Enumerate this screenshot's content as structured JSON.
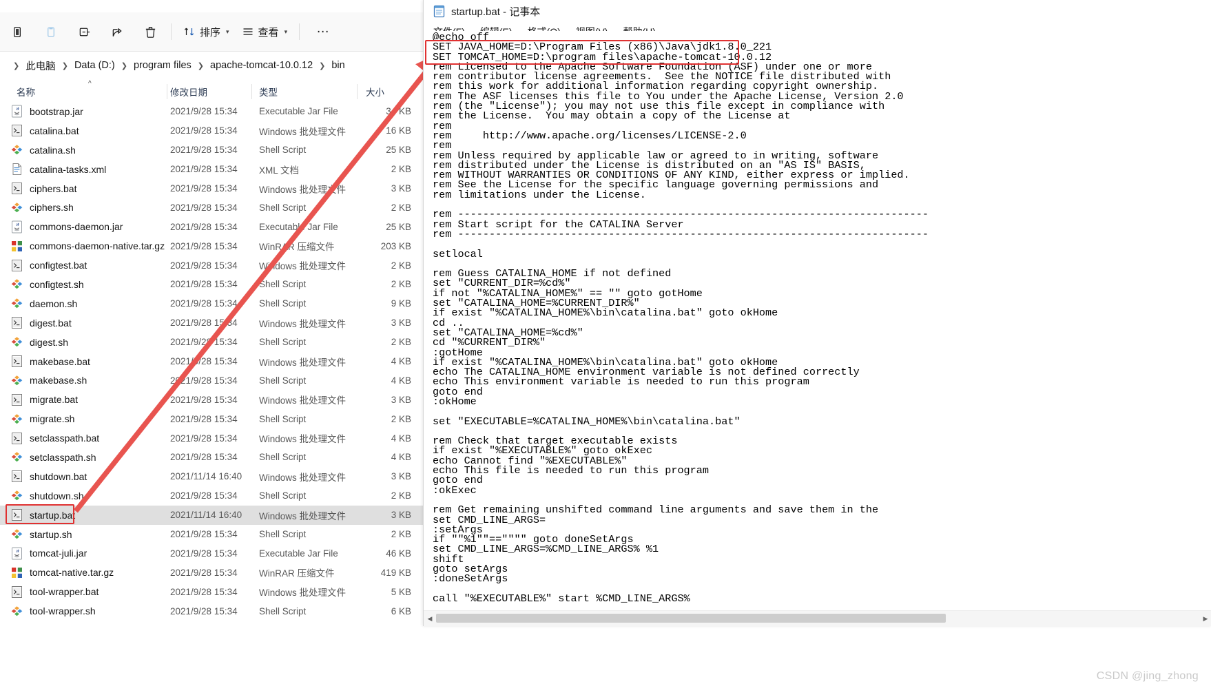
{
  "explorer": {
    "toolbar": {
      "buttons": [
        {
          "name": "cut-icon",
          "label": "剪切"
        },
        {
          "name": "copy-icon",
          "label": "复制"
        },
        {
          "name": "paste-icon",
          "label": "粘贴"
        },
        {
          "name": "share-icon",
          "label": "共享"
        },
        {
          "name": "delete-icon",
          "label": "删除"
        }
      ],
      "sort_label": "排序",
      "view_label": "查看",
      "more_label": "…"
    },
    "breadcrumb": [
      "此电脑",
      "Data (D:)",
      "program files",
      "apache-tomcat-10.0.12",
      "bin"
    ],
    "columns": {
      "name": "名称",
      "date": "修改日期",
      "type": "类型",
      "size": "大小"
    },
    "files": [
      {
        "icon": "jar-file-icon",
        "name": "bootstrap.jar",
        "date": "2021/9/28 15:34",
        "type": "Executable Jar File",
        "size": "34 KB",
        "selected": false
      },
      {
        "icon": "bat-file-icon",
        "name": "catalina.bat",
        "date": "2021/9/28 15:34",
        "type": "Windows 批处理文件",
        "size": "16 KB",
        "selected": false
      },
      {
        "icon": "sh-file-icon",
        "name": "catalina.sh",
        "date": "2021/9/28 15:34",
        "type": "Shell Script",
        "size": "25 KB",
        "selected": false
      },
      {
        "icon": "xml-file-icon",
        "name": "catalina-tasks.xml",
        "date": "2021/9/28 15:34",
        "type": "XML 文档",
        "size": "2 KB",
        "selected": false
      },
      {
        "icon": "bat-file-icon",
        "name": "ciphers.bat",
        "date": "2021/9/28 15:34",
        "type": "Windows 批处理文件",
        "size": "3 KB",
        "selected": false
      },
      {
        "icon": "sh-file-icon",
        "name": "ciphers.sh",
        "date": "2021/9/28 15:34",
        "type": "Shell Script",
        "size": "2 KB",
        "selected": false
      },
      {
        "icon": "jar-file-icon",
        "name": "commons-daemon.jar",
        "date": "2021/9/28 15:34",
        "type": "Executable Jar File",
        "size": "25 KB",
        "selected": false
      },
      {
        "icon": "winrar-file-icon",
        "name": "commons-daemon-native.tar.gz",
        "date": "2021/9/28 15:34",
        "type": "WinRAR 压缩文件",
        "size": "203 KB",
        "selected": false
      },
      {
        "icon": "bat-file-icon",
        "name": "configtest.bat",
        "date": "2021/9/28 15:34",
        "type": "Windows 批处理文件",
        "size": "2 KB",
        "selected": false
      },
      {
        "icon": "sh-file-icon",
        "name": "configtest.sh",
        "date": "2021/9/28 15:34",
        "type": "Shell Script",
        "size": "2 KB",
        "selected": false
      },
      {
        "icon": "sh-file-icon",
        "name": "daemon.sh",
        "date": "2021/9/28 15:34",
        "type": "Shell Script",
        "size": "9 KB",
        "selected": false
      },
      {
        "icon": "bat-file-icon",
        "name": "digest.bat",
        "date": "2021/9/28 15:34",
        "type": "Windows 批处理文件",
        "size": "3 KB",
        "selected": false
      },
      {
        "icon": "sh-file-icon",
        "name": "digest.sh",
        "date": "2021/9/28 15:34",
        "type": "Shell Script",
        "size": "2 KB",
        "selected": false
      },
      {
        "icon": "bat-file-icon",
        "name": "makebase.bat",
        "date": "2021/9/28 15:34",
        "type": "Windows 批处理文件",
        "size": "4 KB",
        "selected": false
      },
      {
        "icon": "sh-file-icon",
        "name": "makebase.sh",
        "date": "2021/9/28 15:34",
        "type": "Shell Script",
        "size": "4 KB",
        "selected": false
      },
      {
        "icon": "bat-file-icon",
        "name": "migrate.bat",
        "date": "2021/9/28 15:34",
        "type": "Windows 批处理文件",
        "size": "3 KB",
        "selected": false
      },
      {
        "icon": "sh-file-icon",
        "name": "migrate.sh",
        "date": "2021/9/28 15:34",
        "type": "Shell Script",
        "size": "2 KB",
        "selected": false
      },
      {
        "icon": "bat-file-icon",
        "name": "setclasspath.bat",
        "date": "2021/9/28 15:34",
        "type": "Windows 批处理文件",
        "size": "4 KB",
        "selected": false
      },
      {
        "icon": "sh-file-icon",
        "name": "setclasspath.sh",
        "date": "2021/9/28 15:34",
        "type": "Shell Script",
        "size": "4 KB",
        "selected": false
      },
      {
        "icon": "bat-file-icon",
        "name": "shutdown.bat",
        "date": "2021/11/14 16:40",
        "type": "Windows 批处理文件",
        "size": "3 KB",
        "selected": false
      },
      {
        "icon": "sh-file-icon",
        "name": "shutdown.sh",
        "date": "2021/9/28 15:34",
        "type": "Shell Script",
        "size": "2 KB",
        "selected": false
      },
      {
        "icon": "bat-file-icon",
        "name": "startup.bat",
        "date": "2021/11/14 16:40",
        "type": "Windows 批处理文件",
        "size": "3 KB",
        "selected": true
      },
      {
        "icon": "sh-file-icon",
        "name": "startup.sh",
        "date": "2021/9/28 15:34",
        "type": "Shell Script",
        "size": "2 KB",
        "selected": false
      },
      {
        "icon": "jar-file-icon",
        "name": "tomcat-juli.jar",
        "date": "2021/9/28 15:34",
        "type": "Executable Jar File",
        "size": "46 KB",
        "selected": false
      },
      {
        "icon": "winrar-file-icon",
        "name": "tomcat-native.tar.gz",
        "date": "2021/9/28 15:34",
        "type": "WinRAR 压缩文件",
        "size": "419 KB",
        "selected": false
      },
      {
        "icon": "bat-file-icon",
        "name": "tool-wrapper.bat",
        "date": "2021/9/28 15:34",
        "type": "Windows 批处理文件",
        "size": "5 KB",
        "selected": false
      },
      {
        "icon": "sh-file-icon",
        "name": "tool-wrapper.sh",
        "date": "2021/9/28 15:34",
        "type": "Shell Script",
        "size": "6 KB",
        "selected": false
      }
    ]
  },
  "notepad": {
    "title": "startup.bat - 记事本",
    "menu": [
      "文件(F)",
      "编辑(E)",
      "格式(O)",
      "视图(V)",
      "帮助(H)"
    ],
    "content": "@echo off\nSET JAVA_HOME=D:\\Program Files (x86)\\Java\\jdk1.8.0_221\nSET TOMCAT_HOME=D:\\program files\\apache-tomcat-10.0.12\nrem Licensed to the Apache Software Foundation (ASF) under one or more\nrem contributor license agreements.  See the NOTICE file distributed with\nrem this work for additional information regarding copyright ownership.\nrem The ASF licenses this file to You under the Apache License, Version 2.0\nrem (the \"License\"); you may not use this file except in compliance with\nrem the License.  You may obtain a copy of the License at\nrem\nrem     http://www.apache.org/licenses/LICENSE-2.0\nrem\nrem Unless required by applicable law or agreed to in writing, software\nrem distributed under the License is distributed on an \"AS IS\" BASIS,\nrem WITHOUT WARRANTIES OR CONDITIONS OF ANY KIND, either express or implied.\nrem See the License for the specific language governing permissions and\nrem limitations under the License.\n\nrem ---------------------------------------------------------------------------\nrem Start script for the CATALINA Server\nrem ---------------------------------------------------------------------------\n\nsetlocal\n\nrem Guess CATALINA_HOME if not defined\nset \"CURRENT_DIR=%cd%\"\nif not \"%CATALINA_HOME%\" == \"\" goto gotHome\nset \"CATALINA_HOME=%CURRENT_DIR%\"\nif exist \"%CATALINA_HOME%\\bin\\catalina.bat\" goto okHome\ncd ..\nset \"CATALINA_HOME=%cd%\"\ncd \"%CURRENT_DIR%\"\n:gotHome\nif exist \"%CATALINA_HOME%\\bin\\catalina.bat\" goto okHome\necho The CATALINA_HOME environment variable is not defined correctly\necho This environment variable is needed to run this program\ngoto end\n:okHome\n\nset \"EXECUTABLE=%CATALINA_HOME%\\bin\\catalina.bat\"\n\nrem Check that target executable exists\nif exist \"%EXECUTABLE%\" goto okExec\necho Cannot find \"%EXECUTABLE%\"\necho This file is needed to run this program\ngoto end\n:okExec\n\nrem Get remaining unshifted command line arguments and save them in the\nset CMD_LINE_ARGS=\n:setArgs\nif \"\"%1\"\"==\"\"\"\" goto doneSetArgs\nset CMD_LINE_ARGS=%CMD_LINE_ARGS% %1\nshift\ngoto setArgs\n:doneSetArgs\n\ncall \"%EXECUTABLE%\" start %CMD_LINE_ARGS%"
  },
  "watermark": "CSDN @jing_zhong",
  "colors": {
    "annotation_red": "#e03131",
    "selection_gray": "#dfdfdf",
    "accent_blue": "#0066cc"
  }
}
